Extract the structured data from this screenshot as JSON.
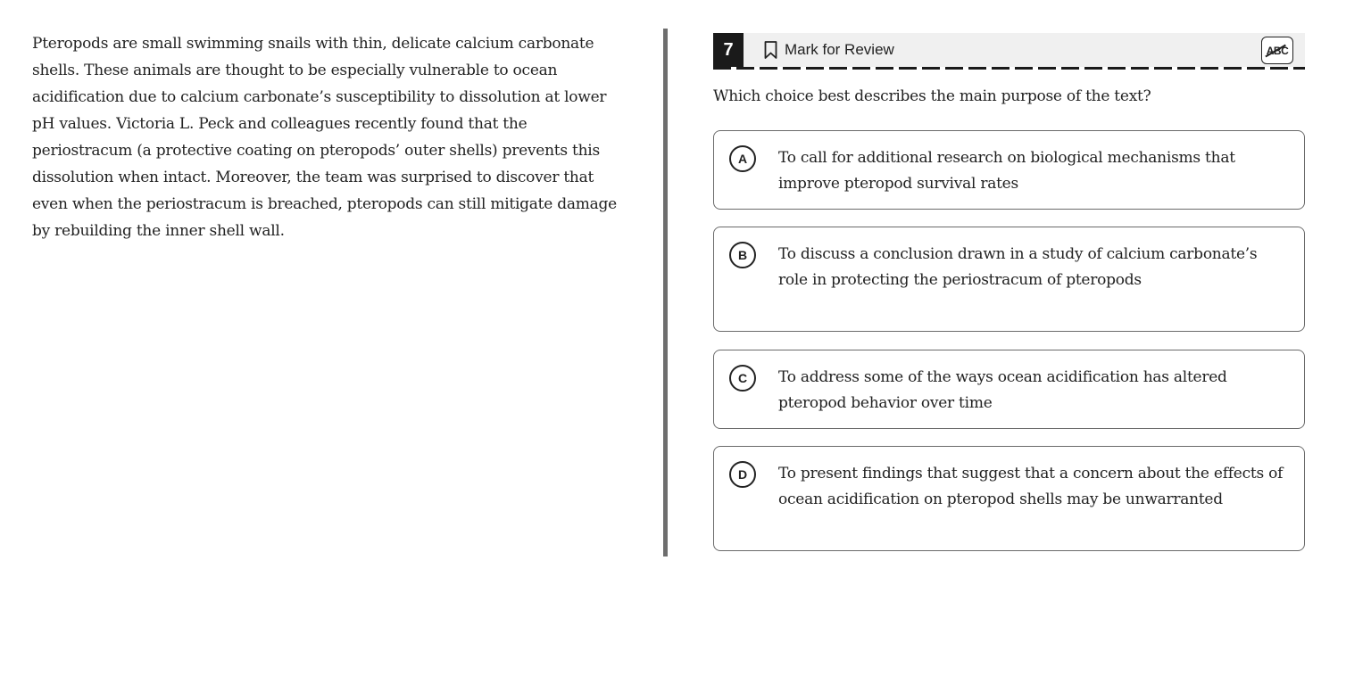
{
  "passage": {
    "text": "Pteropods are small swimming snails with thin, delicate calcium carbonate shells. These animals are thought to be especially vulnerable to ocean acidification due to calcium carbonate’s susceptibility to dissolution at lower pH values. Victoria L. Peck and colleagues recently found that the periostracum (a protective coating on pteropods’ outer shells) prevents this dissolution when intact. Moreover, the team was surprised to discover that even when the periostracum is breached, pteropods can still mitigate damage by rebuilding the inner shell wall."
  },
  "question_header": {
    "number": "7",
    "mark_for_review_label": "Mark for Review",
    "abc_label": "ABC"
  },
  "question": {
    "prompt": "Which choice best describes the main purpose of the text?"
  },
  "choices": [
    {
      "letter": "A",
      "text": "To call for additional research on biological mechanisms that improve pteropod survival rates"
    },
    {
      "letter": "B",
      "text": "To discuss a conclusion drawn in a study of calcium carbonate’s role in protecting the periostracum of pteropods"
    },
    {
      "letter": "C",
      "text": "To address some of the ways ocean acidification has altered pteropod behavior over time"
    },
    {
      "letter": "D",
      "text": "To present findings that suggest that a concern about the effects of ocean acidification on pteropod shells may be unwarranted"
    }
  ]
}
